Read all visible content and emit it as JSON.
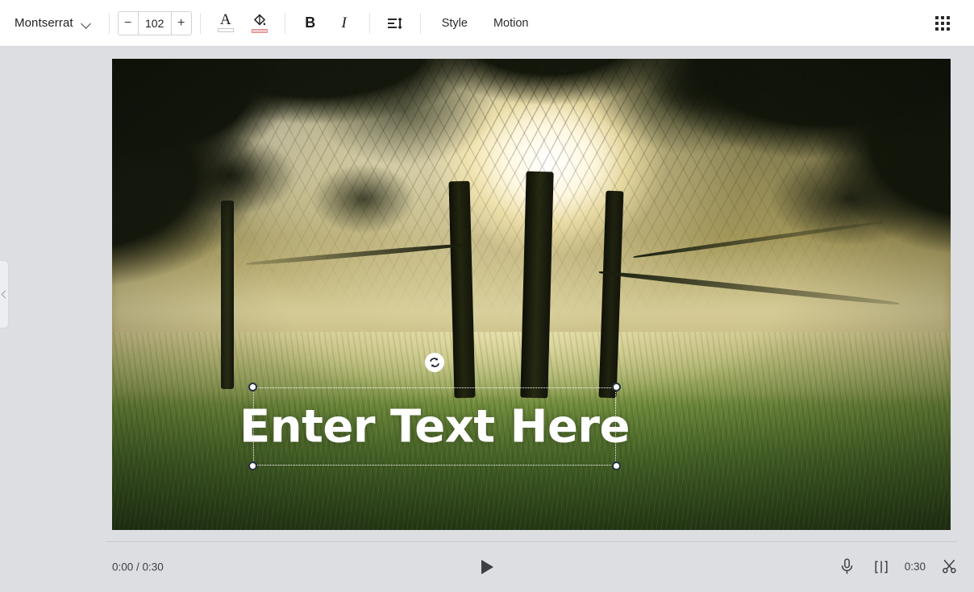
{
  "toolbar": {
    "font_family_value": "Montserrat",
    "font_dropdown_icon": "chevron-down-icon",
    "font_size_decrease_label": "−",
    "font_size_value": "102",
    "font_size_increase_label": "+",
    "text_color_glyph": "A",
    "text_color_swatch_hex": "#ffffff",
    "highlight_color_icon": "paint-bucket-icon",
    "highlight_color_swatch_hex": "#f3c6c6",
    "bold_label": "B",
    "italic_label": "I",
    "line_spacing_icon": "line-spacing-icon",
    "style_label": "Style",
    "motion_label": "Motion",
    "apps_grid_icon": "grid-apps-icon"
  },
  "stage": {
    "panel_collapse_icon": "chevron-left-icon",
    "canvas": {
      "overlay_text": "Enter Text Here",
      "rotate_handle_icon": "rotate-icon",
      "handles": [
        "top-left",
        "top-right",
        "bottom-left",
        "bottom-right"
      ]
    }
  },
  "player": {
    "current_time": "0:00",
    "time_separator": "/",
    "total_time": "0:30",
    "time_display": "0:00 / 0:30",
    "play_icon": "play-icon",
    "mic_icon": "microphone-icon",
    "split_icon": "split-clip-icon",
    "clip_duration": "0:30",
    "trim_icon": "scissors-icon"
  }
}
